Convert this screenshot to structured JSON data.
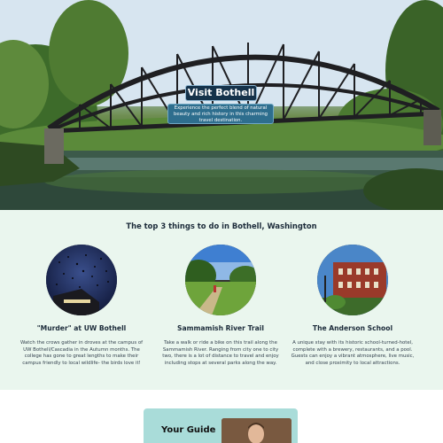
{
  "hero": {
    "title": "Visit Bothell",
    "tagline": "Experience the perfect blend of natural beauty and rich history in this charming travel destination.",
    "image": "truss-bridge-over-river"
  },
  "todo": {
    "heading": "The top 3 things to do in Bothell, Washington",
    "cards": [
      {
        "title": "\"Murder\" at UW Bothell",
        "text": "Watch the crows gather in droves at the campus of UW Bothell/Cascadia in the Autumn months. The college has gone to great lengths to make their campus friendly to local wildlife- the birds love it!",
        "image": "crows-night-sky"
      },
      {
        "title": "Sammamish River Trail",
        "text": "Take a walk or ride a bike on this trail along the Sammamish River. Ranging from city one to city two, there is a lot of distance to travel and enjoy including stops at several parks along the way.",
        "image": "river-trail-cyclist"
      },
      {
        "title": "The Anderson School",
        "text": "A unique stay with its historic school-turned-hotel, complete with a brewery, restaurants, and a pool. Guests can enjoy a vibrant atmosphere, live music, and close proximity to local attractions.",
        "image": "brick-school-building"
      }
    ]
  },
  "guide": {
    "title": "Your Guide",
    "image": "guide-portrait"
  },
  "colors": {
    "hero_title_bg": "#15324a",
    "hero_tagline_bg": "#2e6e8e",
    "todo_bg": "#eaf6ee",
    "guide_bg": "#a9dcd9"
  }
}
